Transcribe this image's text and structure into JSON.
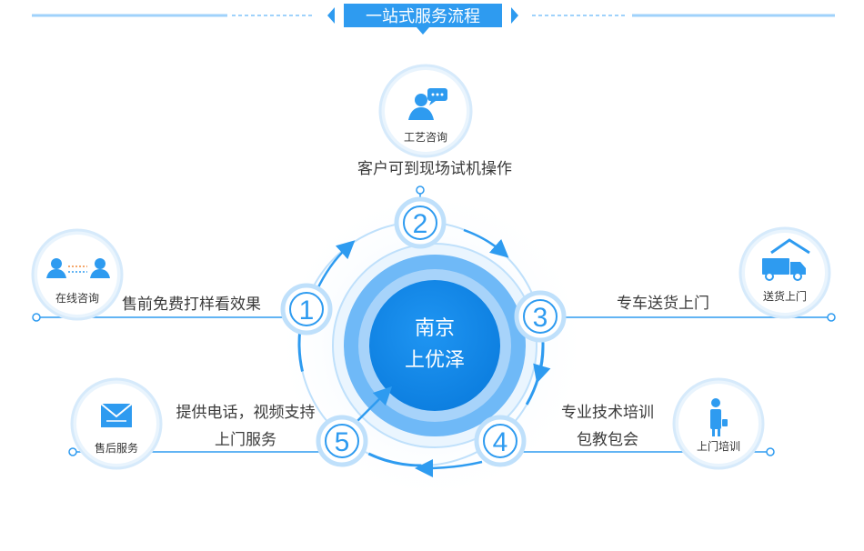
{
  "header": {
    "title": "一站式服务流程"
  },
  "center": {
    "line1": "南京",
    "line2": "上优泽"
  },
  "steps": [
    {
      "num": "1",
      "icon": "two-users-icon",
      "caption": "在线咨询",
      "desc": [
        "售前免费打样看效果"
      ]
    },
    {
      "num": "2",
      "icon": "chat-person-icon",
      "caption": "工艺咨询",
      "desc": [
        "客户可到现场试机操作"
      ]
    },
    {
      "num": "3",
      "icon": "delivery-truck-icon",
      "caption": "送货上门",
      "desc": [
        "专车送货上门"
      ]
    },
    {
      "num": "4",
      "icon": "trainer-icon",
      "caption": "上门培训",
      "desc": [
        "专业技术培训",
        "包教包会"
      ]
    },
    {
      "num": "5",
      "icon": "envelope-icon",
      "caption": "售后服务",
      "desc": [
        "提供电话，视频支持",
        "上门服务"
      ]
    }
  ],
  "colors": {
    "primary": "#2e9bf0",
    "light": "#9fd2fb",
    "ring": "#bfe0fb",
    "text": "#3a3a3a"
  }
}
